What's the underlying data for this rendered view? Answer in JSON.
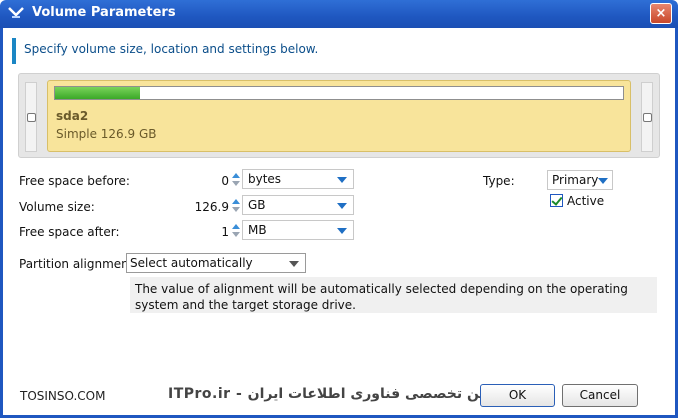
{
  "window": {
    "title": "Volume Parameters",
    "close_label": "×"
  },
  "header": {
    "text": "Specify volume size, location and settings below."
  },
  "partition": {
    "name": "sda2",
    "description": "Simple 126.9 GB",
    "used_fraction": 0.15
  },
  "rows": {
    "free_before": {
      "label": "Free space before:",
      "value": "0",
      "unit": "bytes"
    },
    "volume_size": {
      "label": "Volume size:",
      "value": "126.9",
      "unit": "GB"
    },
    "free_after": {
      "label": "Free space after:",
      "value": "1",
      "unit": "MB"
    }
  },
  "type": {
    "label": "Type:",
    "value": "Primary",
    "active_label": "Active",
    "active_checked": true
  },
  "alignment": {
    "label": "Partition alignment",
    "value": "Select automatically",
    "info": "The value of alignment will be automatically selected depending on the operating system and the target storage drive."
  },
  "footer": {
    "watermark_left": "TOSINSO.COM",
    "watermark_right": "ITPro.ir - انجمن تخصصی فناوری اطلاعات ایران",
    "ok_label": "OK",
    "cancel_label": "Cancel"
  },
  "colors": {
    "accent": "#1f57c0",
    "partition_bg": "#f8e49b",
    "bar_fill": "#3ba828"
  }
}
